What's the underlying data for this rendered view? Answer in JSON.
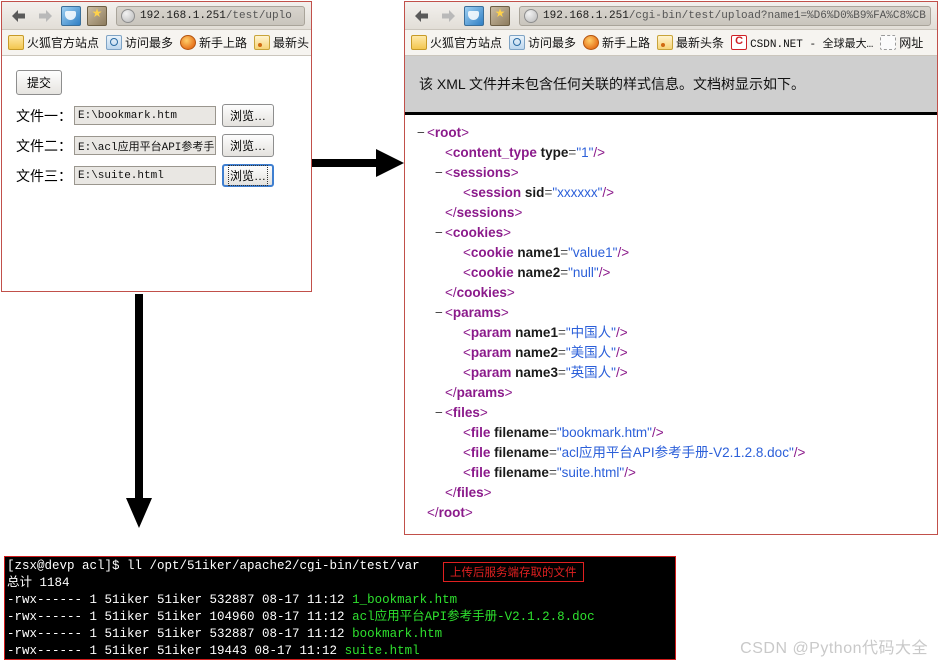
{
  "left_browser": {
    "nav": {
      "back_icon": "back-arrow-icon",
      "forward_icon": "forward-arrow-icon",
      "reload_icon": "reload-icon",
      "home_icon": "home-icon",
      "url_host": "192.168.1.251",
      "url_path": "/test/uplo"
    },
    "bookmarks": [
      {
        "label": "火狐官方站点",
        "icon": "folder-icon"
      },
      {
        "label": "访问最多",
        "icon": "search-icon"
      },
      {
        "label": "新手上路",
        "icon": "firefox-icon"
      },
      {
        "label": "最新头",
        "icon": "rss-icon"
      }
    ],
    "form": {
      "submit_label": "提交",
      "rows": [
        {
          "label": "文件一：",
          "value": "E:\\bookmark.htm",
          "button": "浏览…"
        },
        {
          "label": "文件二：",
          "value": "E:\\acl应用平台API参考手",
          "button": "浏览…"
        },
        {
          "label": "文件三：",
          "value": "E:\\suite.html",
          "button": "浏览…"
        }
      ]
    }
  },
  "right_browser": {
    "nav": {
      "back_icon": "back-arrow-icon",
      "forward_icon": "forward-arrow-icon",
      "reload_icon": "reload-icon",
      "home_icon": "home-icon",
      "url_host": "192.168.1.251",
      "url_path": "/cgi-bin/test/upload?name1=%D6%D0%B9%FA%C8%CB"
    },
    "bookmarks": [
      {
        "label": "火狐官方站点",
        "icon": "folder-icon"
      },
      {
        "label": "访问最多",
        "icon": "search-icon"
      },
      {
        "label": "新手上路",
        "icon": "firefox-icon"
      },
      {
        "label": "最新头条",
        "icon": "rss-icon"
      },
      {
        "label": "CSDN.NET - 全球最大…",
        "icon": "csdn-icon"
      },
      {
        "label": "网址",
        "icon": "dashed-box-icon"
      }
    ],
    "notice": "该 XML 文件并未包含任何关联的样式信息。文档树显示如下。",
    "xml_lines": [
      {
        "indent": 0,
        "twisty": "−",
        "kind": "open",
        "tag": "root"
      },
      {
        "indent": 1,
        "twisty": "",
        "kind": "selfclose",
        "tag": "content_type",
        "attr": "type",
        "value": "1"
      },
      {
        "indent": 1,
        "twisty": "−",
        "kind": "open",
        "tag": "sessions"
      },
      {
        "indent": 2,
        "twisty": "",
        "kind": "selfclose",
        "tag": "session",
        "attr": "sid",
        "value": "xxxxxx"
      },
      {
        "indent": 1,
        "twisty": "",
        "kind": "close",
        "tag": "sessions"
      },
      {
        "indent": 1,
        "twisty": "−",
        "kind": "open",
        "tag": "cookies"
      },
      {
        "indent": 2,
        "twisty": "",
        "kind": "selfclose",
        "tag": "cookie",
        "attr": "name1",
        "value": "value1"
      },
      {
        "indent": 2,
        "twisty": "",
        "kind": "selfclose",
        "tag": "cookie",
        "attr": "name2",
        "value": "null"
      },
      {
        "indent": 1,
        "twisty": "",
        "kind": "close",
        "tag": "cookies"
      },
      {
        "indent": 1,
        "twisty": "−",
        "kind": "open",
        "tag": "params"
      },
      {
        "indent": 2,
        "twisty": "",
        "kind": "selfclose",
        "tag": "param",
        "attr": "name1",
        "value": "中国人"
      },
      {
        "indent": 2,
        "twisty": "",
        "kind": "selfclose",
        "tag": "param",
        "attr": "name2",
        "value": "美国人"
      },
      {
        "indent": 2,
        "twisty": "",
        "kind": "selfclose",
        "tag": "param",
        "attr": "name3",
        "value": "英国人"
      },
      {
        "indent": 1,
        "twisty": "",
        "kind": "close",
        "tag": "params"
      },
      {
        "indent": 1,
        "twisty": "−",
        "kind": "open",
        "tag": "files"
      },
      {
        "indent": 2,
        "twisty": "",
        "kind": "selfclose",
        "tag": "file",
        "attr": "filename",
        "value": "bookmark.htm"
      },
      {
        "indent": 2,
        "twisty": "",
        "kind": "selfclose",
        "tag": "file",
        "attr": "filename",
        "value": "acl应用平台API参考手册-V2.1.2.8.doc"
      },
      {
        "indent": 2,
        "twisty": "",
        "kind": "selfclose",
        "tag": "file",
        "attr": "filename",
        "value": "suite.html"
      },
      {
        "indent": 1,
        "twisty": "",
        "kind": "close",
        "tag": "files"
      },
      {
        "indent": 0,
        "twisty": "",
        "kind": "close",
        "tag": "root"
      }
    ]
  },
  "terminal": {
    "prompt_line": "[zsx@devp acl]$ ll /opt/51iker/apache2/cgi-bin/test/var",
    "total_line": "总计 1184",
    "rows": [
      {
        "meta": "-rwx------ 1 51iker 51iker 532887 08-17 11:12",
        "name": "1_bookmark.htm"
      },
      {
        "meta": "-rwx------ 1 51iker 51iker 104960 08-17 11:12",
        "name": "acl应用平台API参考手册-V2.1.2.8.doc"
      },
      {
        "meta": "-rwx------ 1 51iker 51iker 532887 08-17 11:12",
        "name": "bookmark.htm"
      },
      {
        "meta": "-rwx------ 1 51iker 51iker  19443 08-17 11:12",
        "name": "suite.html"
      }
    ]
  },
  "annotation": "上传后服务端存取的文件",
  "watermark": "CSDN @Python代码大全",
  "colors": {
    "panel_border": "#c1504a",
    "xml_tag": "#8b1a8b",
    "xml_value": "#2b5fd9",
    "terminal_bg": "#000000",
    "terminal_file": "#2ee02e",
    "annotation": "#e02020"
  }
}
